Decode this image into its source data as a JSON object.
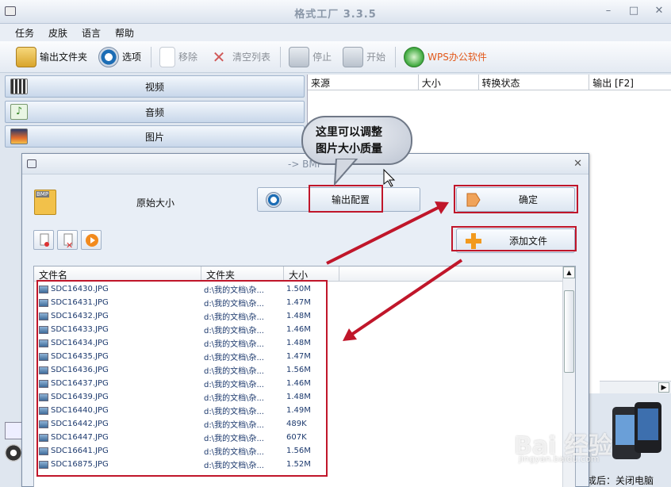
{
  "window": {
    "title": "格式工厂 3.3.5"
  },
  "menu": [
    "任务",
    "皮肤",
    "语言",
    "帮助"
  ],
  "toolbar": {
    "output_folder": "输出文件夹",
    "options": "选项",
    "remove": "移除",
    "clear_list": "清空列表",
    "stop": "停止",
    "start": "开始",
    "wps": "WPS办公软件"
  },
  "categories": [
    "视频",
    "音频",
    "图片"
  ],
  "task_columns": [
    "来源",
    "大小",
    "转换状态",
    "输出 [F2]"
  ],
  "status_text": "成后：关闭电脑",
  "dialog": {
    "title": "-> BMP",
    "format_badge": "BMP",
    "original_size": "原始大小",
    "output_config": "输出配置",
    "ok": "确定",
    "add_file": "添加文件",
    "columns": [
      "文件名",
      "文件夹",
      "大小"
    ],
    "files": [
      {
        "name": "SDC16430.JPG",
        "folder": "d:\\我的文档\\杂...",
        "size": "1.50M"
      },
      {
        "name": "SDC16431.JPG",
        "folder": "d:\\我的文档\\杂...",
        "size": "1.47M"
      },
      {
        "name": "SDC16432.JPG",
        "folder": "d:\\我的文档\\杂...",
        "size": "1.48M"
      },
      {
        "name": "SDC16433.JPG",
        "folder": "d:\\我的文档\\杂...",
        "size": "1.46M"
      },
      {
        "name": "SDC16434.JPG",
        "folder": "d:\\我的文档\\杂...",
        "size": "1.48M"
      },
      {
        "name": "SDC16435.JPG",
        "folder": "d:\\我的文档\\杂...",
        "size": "1.47M"
      },
      {
        "name": "SDC16436.JPG",
        "folder": "d:\\我的文档\\杂...",
        "size": "1.56M"
      },
      {
        "name": "SDC16437.JPG",
        "folder": "d:\\我的文档\\杂...",
        "size": "1.46M"
      },
      {
        "name": "SDC16439.JPG",
        "folder": "d:\\我的文档\\杂...",
        "size": "1.48M"
      },
      {
        "name": "SDC16440.JPG",
        "folder": "d:\\我的文档\\杂...",
        "size": "1.49M"
      },
      {
        "name": "SDC16442.JPG",
        "folder": "d:\\我的文档\\杂...",
        "size": "489K"
      },
      {
        "name": "SDC16447.JPG",
        "folder": "d:\\我的文档\\杂...",
        "size": "607K"
      },
      {
        "name": "SDC16641.JPG",
        "folder": "d:\\我的文档\\杂...",
        "size": "1.56M"
      },
      {
        "name": "SDC16875.JPG",
        "folder": "d:\\我的文档\\杂...",
        "size": "1.52M"
      }
    ]
  },
  "annotation": {
    "callout_line1": "这里可以调整",
    "callout_line2": "图片大小质量",
    "color": "#c0162a"
  },
  "watermark": {
    "logo": "Bai 经验",
    "url": "jingyan.baidu.com"
  }
}
